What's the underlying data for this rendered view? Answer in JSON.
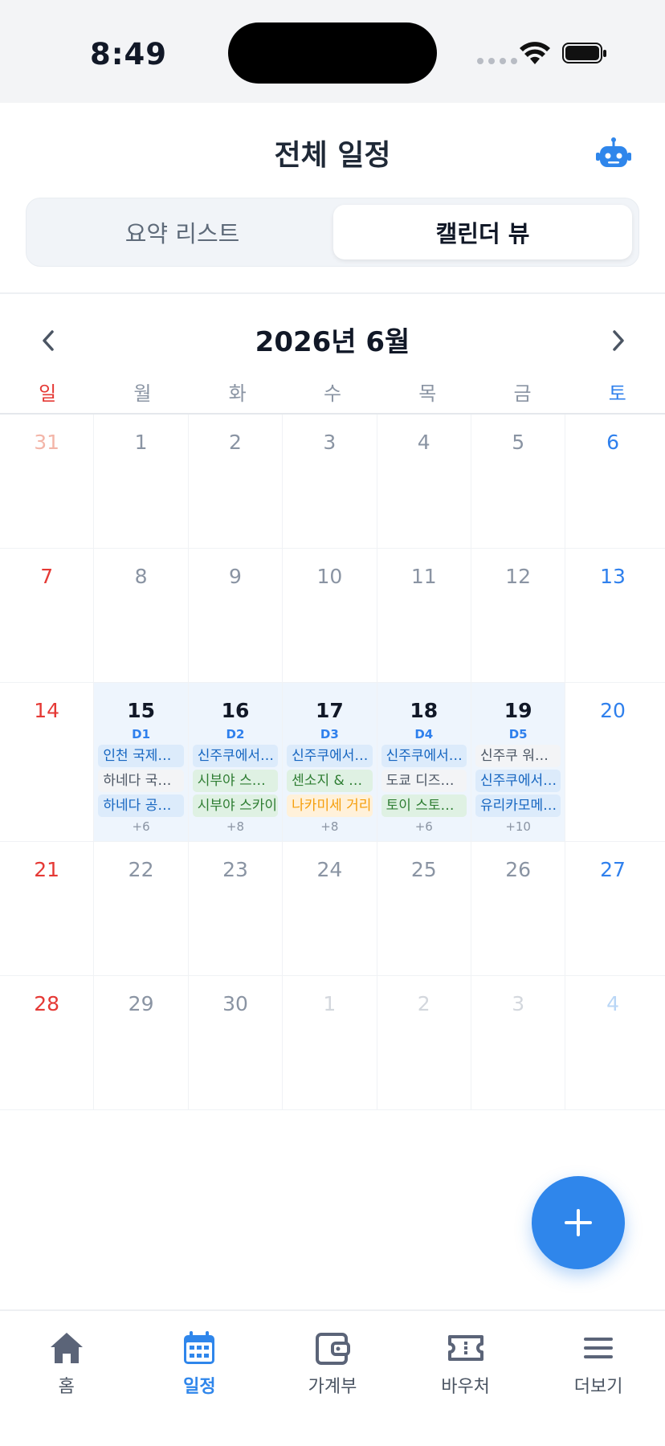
{
  "status_bar": {
    "time": "8:49"
  },
  "header": {
    "title": "전체 일정"
  },
  "segmented": {
    "list_label": "요약 리스트",
    "calendar_label": "캘린더 뷰"
  },
  "calendar": {
    "month_title": "2026년 6월",
    "weekdays": [
      "일",
      "월",
      "화",
      "수",
      "목",
      "금",
      "토"
    ],
    "weeks": [
      [
        {
          "day": "31",
          "other": true
        },
        {
          "day": "1"
        },
        {
          "day": "2"
        },
        {
          "day": "3"
        },
        {
          "day": "4"
        },
        {
          "day": "5"
        },
        {
          "day": "6"
        }
      ],
      [
        {
          "day": "7"
        },
        {
          "day": "8"
        },
        {
          "day": "9"
        },
        {
          "day": "10"
        },
        {
          "day": "11"
        },
        {
          "day": "12"
        },
        {
          "day": "13"
        }
      ],
      [
        {
          "day": "14"
        },
        {
          "day": "15",
          "dlabel": "D1",
          "events": [
            {
              "text": "인천 국제공항 출발",
              "color": "blue"
            },
            {
              "text": "하네다 국제공항 도착",
              "color": "gray"
            },
            {
              "text": "하네다 공항 이동",
              "color": "blue"
            }
          ],
          "more": "+6"
        },
        {
          "day": "16",
          "dlabel": "D2",
          "events": [
            {
              "text": "신주쿠에서 출발",
              "color": "blue"
            },
            {
              "text": "시부야 스크램블",
              "color": "green"
            },
            {
              "text": "시부야 스카이",
              "color": "green"
            }
          ],
          "more": "+8"
        },
        {
          "day": "17",
          "dlabel": "D3",
          "events": [
            {
              "text": "신주쿠에서 출발",
              "color": "blue"
            },
            {
              "text": "센소지 & 아사쿠사",
              "color": "green"
            },
            {
              "text": "나카미세 거리",
              "color": "orange"
            }
          ],
          "more": "+8"
        },
        {
          "day": "18",
          "dlabel": "D4",
          "events": [
            {
              "text": "신주쿠에서 출발",
              "color": "blue"
            },
            {
              "text": "도쿄 디즈니랜드",
              "color": "gray"
            },
            {
              "text": "토이 스토리 마니아",
              "color": "green"
            }
          ],
          "more": "+6"
        },
        {
          "day": "19",
          "dlabel": "D5",
          "events": [
            {
              "text": "신주쿠 워싱턴 호텔",
              "color": "gray"
            },
            {
              "text": "신주쿠에서 출발",
              "color": "blue"
            },
            {
              "text": "유리카모메 탑승",
              "color": "blue"
            }
          ],
          "more": "+10"
        },
        {
          "day": "20"
        }
      ],
      [
        {
          "day": "21"
        },
        {
          "day": "22"
        },
        {
          "day": "23"
        },
        {
          "day": "24"
        },
        {
          "day": "25"
        },
        {
          "day": "26"
        },
        {
          "day": "27"
        }
      ],
      [
        {
          "day": "28"
        },
        {
          "day": "29"
        },
        {
          "day": "30"
        },
        {
          "day": "1",
          "other": true
        },
        {
          "day": "2",
          "other": true
        },
        {
          "day": "3",
          "other": true
        },
        {
          "day": "4",
          "other": true
        }
      ]
    ]
  },
  "tabbar": [
    {
      "label": "홈",
      "icon": "home-icon"
    },
    {
      "label": "일정",
      "icon": "calendar-icon",
      "active": true
    },
    {
      "label": "가계부",
      "icon": "wallet-icon"
    },
    {
      "label": "바우처",
      "icon": "ticket-icon"
    },
    {
      "label": "더보기",
      "icon": "menu-icon"
    }
  ],
  "colors": {
    "accent": "#2f86eb",
    "sunday": "#e53935",
    "saturday": "#2f80ed"
  }
}
